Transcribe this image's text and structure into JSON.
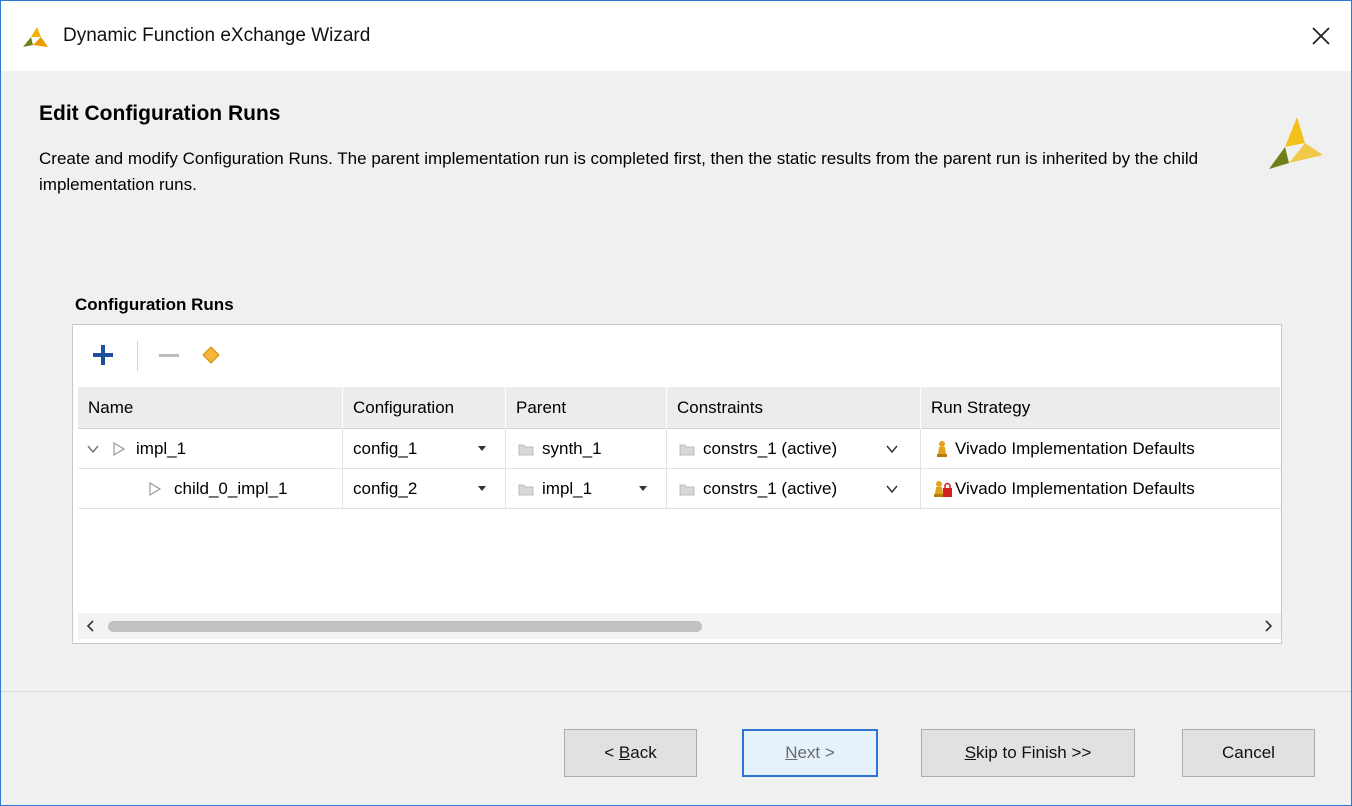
{
  "window": {
    "title": "Dynamic Function eXchange Wizard",
    "accent": "#2b7bd6"
  },
  "header": {
    "heading": "Edit Configuration Runs",
    "description": "Create and modify Configuration Runs. The parent implementation run is completed first, then the static results from the parent run is inherited by the child implementation runs."
  },
  "section": {
    "label": "Configuration Runs"
  },
  "toolbar": {
    "add_icon": "plus-icon",
    "remove_icon": "minus-icon",
    "auto_icon": "diamond-icon"
  },
  "table": {
    "columns": [
      "Name",
      "Configuration",
      "Parent",
      "Constraints",
      "Run Strategy"
    ],
    "rows": [
      {
        "name": "impl_1",
        "configuration": "config_1",
        "parent": "synth_1",
        "constraints": "constrs_1 (active)",
        "run_strategy": "Vivado Implementation Defaults"
      },
      {
        "name": "child_0_impl_1",
        "configuration": "config_2",
        "parent": "impl_1",
        "constraints": "constrs_1 (active)",
        "run_strategy": "Vivado Implementation Defaults"
      }
    ],
    "scroll_fraction": 0.49
  },
  "buttons": {
    "back_prefix": "< ",
    "back_key": "B",
    "back_rest": "ack",
    "next_key": "N",
    "next_rest": "ext >",
    "skip_key": "S",
    "skip_rest": "kip to Finish >>",
    "cancel": "Cancel"
  }
}
